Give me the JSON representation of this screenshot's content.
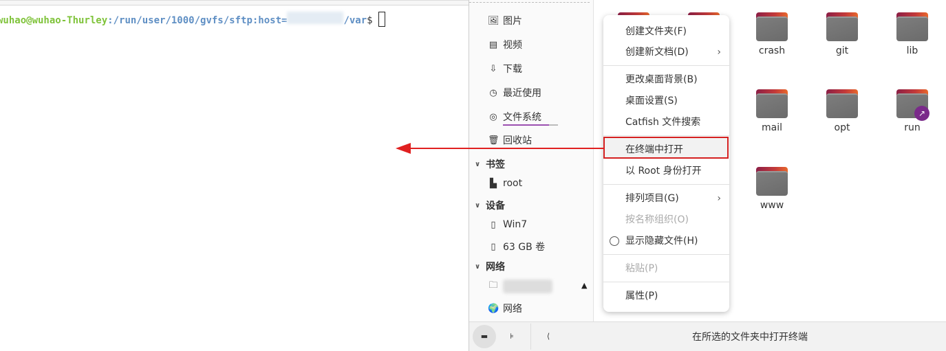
{
  "terminal": {
    "user_host": "wuhao@wuhao-Thurley",
    "path_prefix": ":/run/user/1000/gvfs/sftp:host=",
    "path_suffix": "/var",
    "prompt_symbol": "$"
  },
  "sidebar": {
    "places": [
      {
        "icon": "image-icon",
        "label": "图片"
      },
      {
        "icon": "film-icon",
        "label": "视频"
      },
      {
        "icon": "download-icon",
        "label": "下载"
      },
      {
        "icon": "clock-icon",
        "label": "最近使用"
      },
      {
        "icon": "disk-icon",
        "label": "文件系统"
      },
      {
        "icon": "trash-icon",
        "label": "回收站"
      }
    ],
    "bookmarks_header": "书签",
    "bookmarks": [
      {
        "icon": "folder-locked-icon",
        "label": "root"
      }
    ],
    "devices_header": "设备",
    "devices": [
      {
        "icon": "drive-icon",
        "label": "Win7"
      },
      {
        "icon": "drive-icon",
        "label": "63 GB 卷"
      }
    ],
    "network_header": "网络",
    "network": [
      {
        "icon": "network-folder-icon",
        "label": ""
      },
      {
        "icon": "globe-icon",
        "label": "网络"
      }
    ]
  },
  "folders": [
    "crash",
    "git",
    "lib",
    "mail",
    "opt",
    "run",
    "www"
  ],
  "context_menu": {
    "items": [
      {
        "label": "创建文件夹(F)"
      },
      {
        "label": "创建新文档(D)",
        "submenu": true
      },
      {
        "label": "更改桌面背景(B)"
      },
      {
        "label": "桌面设置(S)"
      },
      {
        "label": "Catfish 文件搜索"
      },
      {
        "label": "在终端中打开",
        "highlighted": true
      },
      {
        "label": "以 Root 身份打开"
      },
      {
        "label": "排列项目(G)",
        "submenu": true
      },
      {
        "label": "按名称组织(O)",
        "disabled": true
      },
      {
        "label": "显示隐藏文件(H)",
        "radio": true
      },
      {
        "label": "粘贴(P)",
        "disabled": true
      },
      {
        "label": "属性(P)"
      }
    ],
    "submenu_arrow": "›"
  },
  "statusbar": {
    "text": "在所选的文件夹中打开终端"
  },
  "colors": {
    "highlight_border": "#d42020",
    "arrow": "#e02020",
    "prompt_user": "#7fc33a",
    "prompt_path": "#5f8fc4",
    "accent": "#9b4fb0"
  }
}
